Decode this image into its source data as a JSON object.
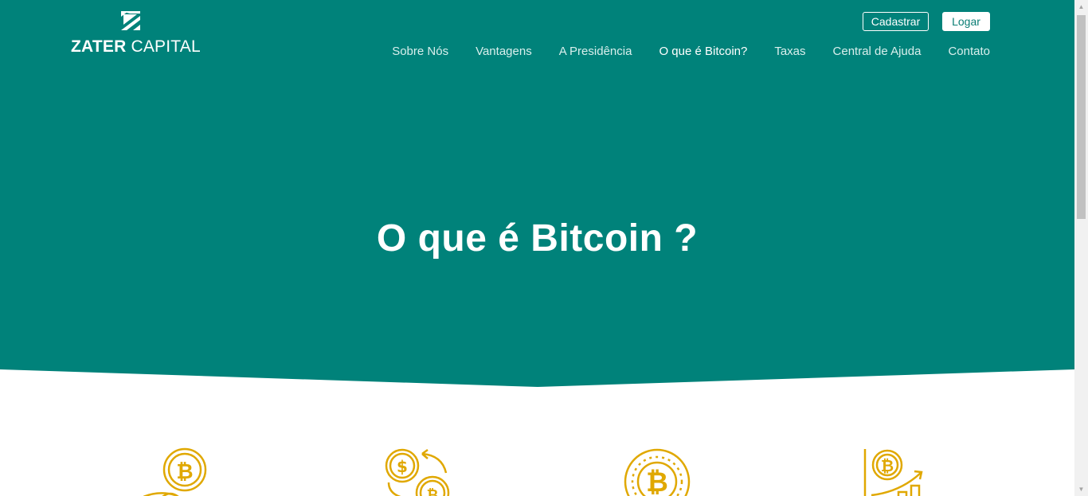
{
  "colors": {
    "brand_teal": "#00827A",
    "icon_gold": "#E0A800",
    "white": "#FFFFFF"
  },
  "logo": {
    "text_bold": "ZATER",
    "text_light": " CAPITAL",
    "mark_icon": "zater-z-mark-icon"
  },
  "header": {
    "register_label": "Cadastrar",
    "login_label": "Logar"
  },
  "nav": {
    "items": [
      {
        "label": "Sobre Nós"
      },
      {
        "label": "Vantagens"
      },
      {
        "label": "A Presidência"
      },
      {
        "label": "O que é Bitcoin?",
        "active": true
      },
      {
        "label": "Taxas"
      },
      {
        "label": "Central de Ajuda"
      },
      {
        "label": "Contato"
      }
    ]
  },
  "hero": {
    "title": "O que é Bitcoin ?"
  },
  "features": {
    "icons": [
      "bitcoin-coins-hand-icon",
      "dollar-bitcoin-exchange-icon",
      "bitcoin-coin-icon",
      "bitcoin-growth-chart-icon"
    ]
  }
}
